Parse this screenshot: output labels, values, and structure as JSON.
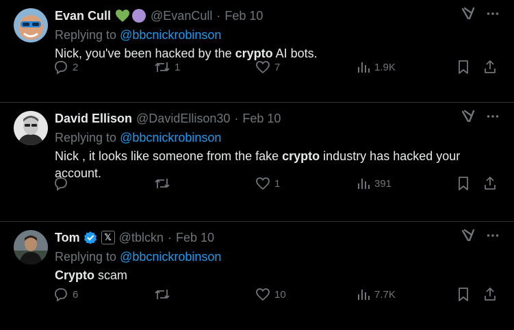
{
  "tweets": [
    {
      "name": "Evan Cull",
      "handle": "@EvanCull",
      "separator": "·",
      "date": "Feb 10",
      "replying_prefix": "Replying to ",
      "replying_to": "@bbcnickrobinson",
      "text_before": "Nick, you've been hacked by the ",
      "text_bold": "crypto",
      "text_after": " AI bots.",
      "replies": "2",
      "retweets": "1",
      "likes": "7",
      "views": "1.9K",
      "emoji": [
        "green-heart",
        "purple-circle"
      ]
    },
    {
      "name": "David Ellison",
      "handle": "@DavidEllison30",
      "separator": "·",
      "date": "Feb 10",
      "replying_prefix": "Replying to ",
      "replying_to": "@bbcnickrobinson",
      "text_before": "Nick , it looks like someone from the fake ",
      "text_bold": "crypto",
      "text_after": " industry has hacked your account.",
      "replies": "",
      "retweets": "",
      "likes": "1",
      "views": "391"
    },
    {
      "name": "Tom",
      "handle": "@tblckn",
      "separator": "·",
      "date": "Feb 10",
      "replying_prefix": "Replying to ",
      "replying_to": "@bbcnickrobinson",
      "text_before": "",
      "text_bold": "Crypto",
      "text_after": " scam",
      "replies": "6",
      "retweets": "",
      "likes": "10",
      "views": "7.7K",
      "verified": true,
      "affiliate_badge": "𝕏"
    }
  ],
  "colors": {
    "background": "#000000",
    "text": "#e7e9ea",
    "muted": "#71767b",
    "link": "#1d9bf0",
    "divider": "#2f3336",
    "verified": "#1d9bf0",
    "green_heart": "#77b255",
    "purple_circle": "#aa8ed6"
  },
  "icons": [
    "grok-icon",
    "more-icon",
    "reply-icon",
    "retweet-icon",
    "like-icon",
    "views-icon",
    "bookmark-icon",
    "share-icon"
  ]
}
